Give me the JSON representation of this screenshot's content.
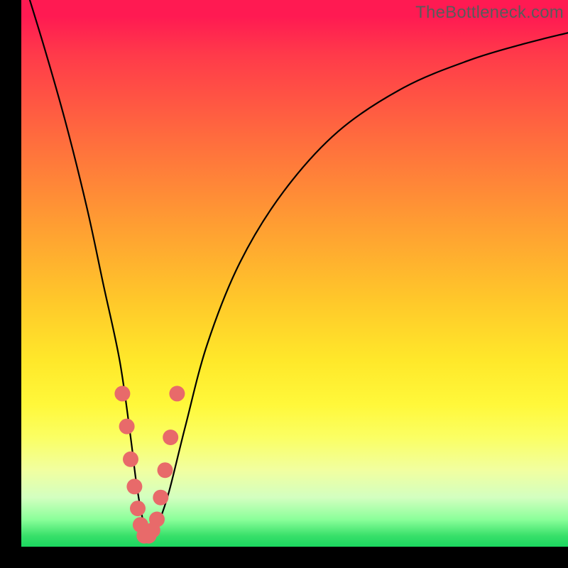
{
  "watermark": "TheBottleneck.com",
  "colors": {
    "frame": "#000000",
    "curve": "#000000",
    "dot": "#e86a6a",
    "gradient_top": "#ff1a52",
    "gradient_mid1": "#ff9a33",
    "gradient_mid2": "#ffe82a",
    "gradient_bottom": "#1bd65f"
  },
  "chart_data": {
    "type": "line",
    "title": "",
    "xlabel": "",
    "ylabel": "",
    "xlim": [
      0,
      100
    ],
    "ylim": [
      0,
      100
    ],
    "note": "V-shaped bottleneck curve. x ≈ relative performance score; y ≈ bottleneck %. Values estimated from pixel position.",
    "series": [
      {
        "name": "bottleneck-curve",
        "x": [
          0,
          4,
          8,
          12,
          15,
          18,
          20,
          21,
          22,
          23,
          24,
          25,
          27,
          30,
          34,
          40,
          48,
          58,
          70,
          82,
          92,
          100
        ],
        "y": [
          105,
          92,
          78,
          62,
          48,
          34,
          20,
          12,
          6,
          2,
          2,
          4,
          10,
          22,
          37,
          52,
          65,
          76,
          84,
          89,
          92,
          94
        ]
      }
    ],
    "markers": {
      "name": "highlighted-points",
      "note": "salmon dots clustered near the trough",
      "x": [
        18.5,
        19.3,
        20.0,
        20.7,
        21.3,
        21.8,
        22.5,
        23.3,
        24.0,
        24.8,
        25.5,
        26.3,
        27.3,
        28.5
      ],
      "y": [
        28,
        22,
        16,
        11,
        7,
        4,
        2,
        2,
        3,
        5,
        9,
        14,
        20,
        28
      ]
    }
  }
}
